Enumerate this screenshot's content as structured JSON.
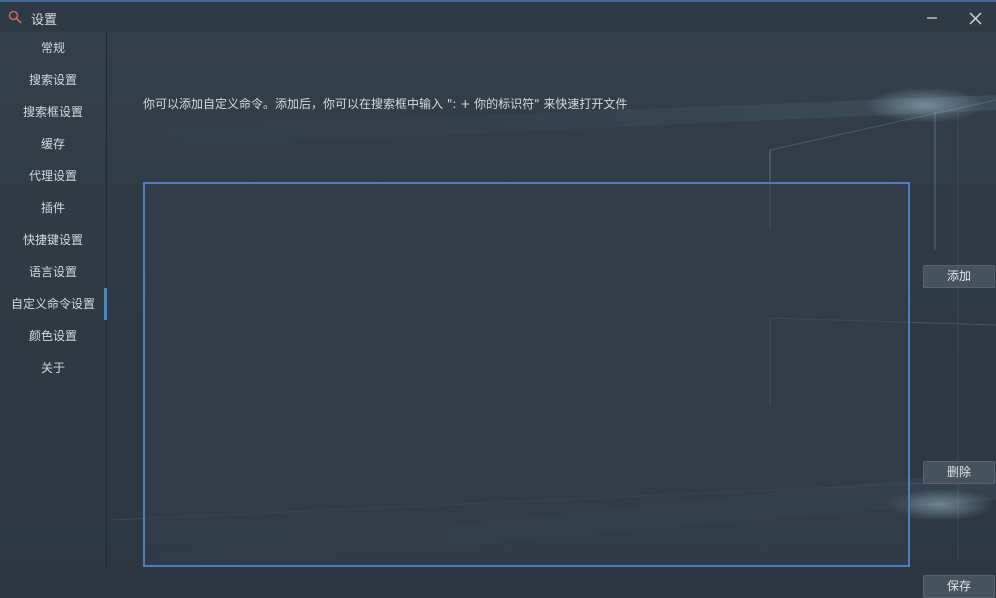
{
  "window": {
    "title": "设置",
    "minimize_symbol": "—",
    "close_symbol": "✕"
  },
  "sidebar": {
    "items": [
      {
        "label": "常规"
      },
      {
        "label": "搜索设置"
      },
      {
        "label": "搜索框设置"
      },
      {
        "label": "缓存"
      },
      {
        "label": "代理设置"
      },
      {
        "label": "插件"
      },
      {
        "label": "快捷键设置"
      },
      {
        "label": "语言设置"
      },
      {
        "label": "自定义命令设置",
        "active": true
      },
      {
        "label": "颜色设置"
      },
      {
        "label": "关于"
      }
    ]
  },
  "main": {
    "description": "你可以添加自定义命令。添加后，你可以在搜索框中输入 \": + 你的标识符\" 来快速打开文件",
    "add_label": "添加",
    "delete_label": "删除",
    "save_label": "保存"
  },
  "colors": {
    "accent": "#4a86c8",
    "background": "#2f3a45",
    "text": "#d4dade"
  }
}
